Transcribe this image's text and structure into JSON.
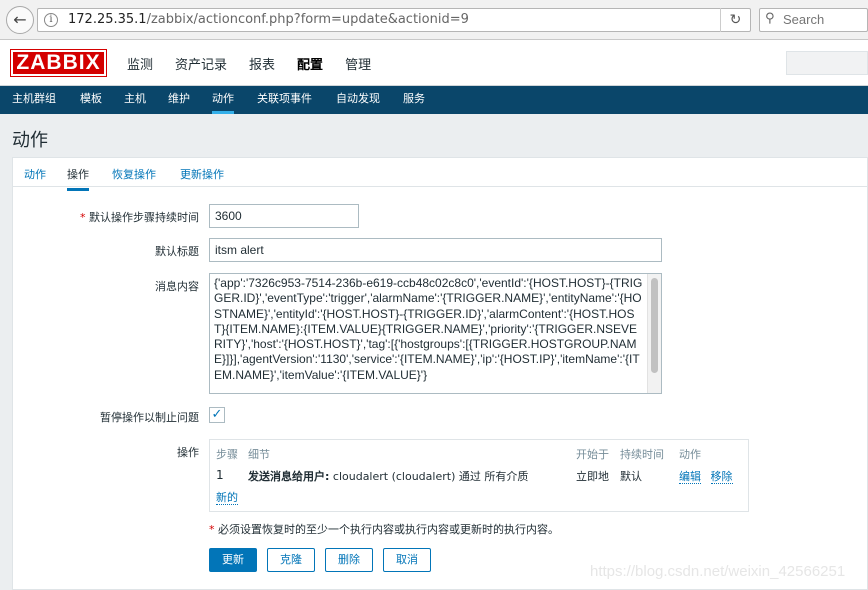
{
  "browser": {
    "url_host": "172.25.35.1",
    "url_path": "/zabbix/actionconf.php?form=update&actionid=9",
    "search_placeholder": "Search"
  },
  "logo": "ZABBIX",
  "main_menu": [
    "监测",
    "资产记录",
    "报表",
    "配置",
    "管理"
  ],
  "sub_menu": [
    "主机群组",
    "模板",
    "主机",
    "维护",
    "动作",
    "关联项事件",
    "自动发现",
    "服务"
  ],
  "page_title": "动作",
  "tabs": [
    "动作",
    "操作",
    "恢复操作",
    "更新操作"
  ],
  "form": {
    "step_duration_label": "默认操作步骤持续时间",
    "step_duration_value": "3600",
    "subject_label": "默认标题",
    "subject_value": "itsm alert",
    "message_label": "消息内容",
    "message_value": "{'app':'7326c953-7514-236b-e619-ccb48c02c8c0','eventId':'{HOST.HOST}-{TRIGGER.ID}','eventType':'trigger','alarmName':'{TRIGGER.NAME}','entityName':'{HOSTNAME}','entityId':'{HOST.HOST}-{TRIGGER.ID}','alarmContent':'{HOST.HOST}{ITEM.NAME}:{ITEM.VALUE}{TRIGGER.NAME}','priority':'{TRIGGER.NSEVERITY}','host':'{HOST.HOST}','tag':[{'hostgroups':[{TRIGGER.HOSTGROUP.NAME}]}],'agentVersion':'1130','service':'{ITEM.NAME}','ip':'{HOST.IP}','itemName':'{ITEM.NAME}','itemValue':'{ITEM.VALUE}'}",
    "pause_label": "暂停操作以制止问题",
    "pause_checked": true,
    "operations_label": "操作"
  },
  "operations": {
    "headers": [
      "步骤",
      "细节",
      "开始于",
      "持续时间",
      "动作"
    ],
    "row": {
      "step": "1",
      "details_bold": "发送消息给用户:",
      "details_rest": " cloudalert (cloudalert) 通过 所有介质",
      "start": "立即地",
      "duration": "默认",
      "edit": "编辑",
      "remove": "移除"
    },
    "new_link": "新的"
  },
  "note": "必须设置恢复时的至少一个执行内容或执行内容或更新时的执行内容。",
  "buttons": [
    "更新",
    "克隆",
    "删除",
    "取消"
  ],
  "watermark": "https://blog.csdn.net/weixin_42566251"
}
